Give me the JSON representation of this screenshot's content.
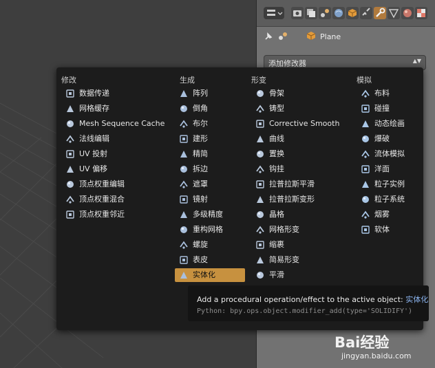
{
  "header": {
    "object_name": "Plane"
  },
  "add_modifier": {
    "label": "添加修改器"
  },
  "columns": [
    {
      "title": "修改",
      "items": [
        {
          "label": "数据传递",
          "icon": "data-transfer-icon"
        },
        {
          "label": "网格缓存",
          "icon": "mesh-cache-icon"
        },
        {
          "label": "Mesh Sequence Cache",
          "icon": "mesh-sequence-cache-icon"
        },
        {
          "label": "法线编辑",
          "icon": "normal-edit-icon"
        },
        {
          "label": "UV 投射",
          "icon": "uv-project-icon"
        },
        {
          "label": "UV 偏移",
          "icon": "uv-warp-icon"
        },
        {
          "label": "顶点权重编辑",
          "icon": "vertex-weight-edit-icon"
        },
        {
          "label": "顶点权重混合",
          "icon": "vertex-weight-mix-icon"
        },
        {
          "label": "顶点权重邻近",
          "icon": "vertex-weight-proximity-icon"
        }
      ]
    },
    {
      "title": "生成",
      "items": [
        {
          "label": "阵列",
          "icon": "array-icon"
        },
        {
          "label": "倒角",
          "icon": "bevel-icon"
        },
        {
          "label": "布尔",
          "icon": "boolean-icon"
        },
        {
          "label": "建形",
          "icon": "build-icon"
        },
        {
          "label": "精简",
          "icon": "decimate-icon"
        },
        {
          "label": "拆边",
          "icon": "edge-split-icon"
        },
        {
          "label": "遮罩",
          "icon": "mask-icon"
        },
        {
          "label": "镜射",
          "icon": "mirror-icon"
        },
        {
          "label": "多级精度",
          "icon": "multires-icon"
        },
        {
          "label": "重构网格",
          "icon": "remesh-icon"
        },
        {
          "label": "螺旋",
          "icon": "screw-icon"
        },
        {
          "label": "表皮",
          "icon": "skin-icon"
        },
        {
          "label": "实体化",
          "icon": "solidify-icon"
        }
      ]
    },
    {
      "title": "形变",
      "items": [
        {
          "label": "骨架",
          "icon": "armature-icon"
        },
        {
          "label": "铸型",
          "icon": "cast-icon"
        },
        {
          "label": "Corrective Smooth",
          "icon": "corrective-smooth-icon"
        },
        {
          "label": "曲线",
          "icon": "curve-icon"
        },
        {
          "label": "置换",
          "icon": "displace-icon"
        },
        {
          "label": "钩挂",
          "icon": "hook-icon"
        },
        {
          "label": "拉普拉斯平滑",
          "icon": "laplacian-smooth-icon"
        },
        {
          "label": "拉普拉斯变形",
          "icon": "laplacian-deform-icon"
        },
        {
          "label": "晶格",
          "icon": "lattice-icon"
        },
        {
          "label": "网格形变",
          "icon": "mesh-deform-icon"
        },
        {
          "label": "缩裹",
          "icon": "shrinkwrap-icon"
        },
        {
          "label": "简易形变",
          "icon": "simple-deform-icon"
        },
        {
          "label": "平滑",
          "icon": "smooth-icon"
        }
      ]
    },
    {
      "title": "模拟",
      "items": [
        {
          "label": "布料",
          "icon": "cloth-icon"
        },
        {
          "label": "碰撞",
          "icon": "collision-icon"
        },
        {
          "label": "动态绘画",
          "icon": "dynamic-paint-icon"
        },
        {
          "label": "爆破",
          "icon": "explode-icon"
        },
        {
          "label": "流体模拟",
          "icon": "fluid-icon"
        },
        {
          "label": "洋面",
          "icon": "ocean-icon"
        },
        {
          "label": "粒子实例",
          "icon": "particle-instance-icon"
        },
        {
          "label": "粒子系统",
          "icon": "particle-system-icon"
        },
        {
          "label": "烟雾",
          "icon": "smoke-icon"
        },
        {
          "label": "软体",
          "icon": "soft-body-icon"
        }
      ]
    }
  ],
  "selected_item": "实体化",
  "tooltip": {
    "description": "Add a procedural operation/effect to the active object:",
    "item_name": "实体化",
    "python": "Python: bpy.ops.object.modifier_add(type='SOLIDIFY')"
  },
  "watermark": {
    "logo": "Bai经验",
    "url": "jingyan.baidu.com"
  },
  "colors": {
    "accent": "#c7913f",
    "tooltip_link": "#8cb5f0",
    "menu_bg": "#1c1c1c"
  }
}
